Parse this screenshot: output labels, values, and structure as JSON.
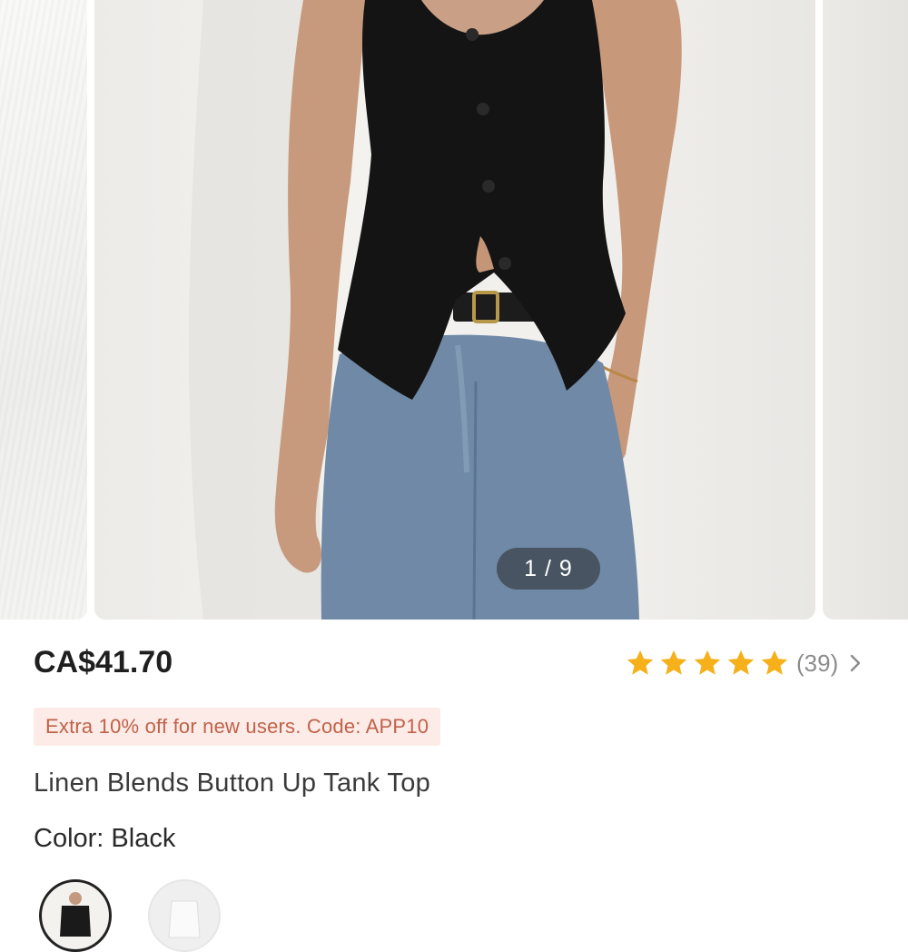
{
  "gallery": {
    "counter": "1 / 9",
    "current": 1,
    "total": 9
  },
  "product": {
    "price": "CA$41.70",
    "rating_value": 5,
    "review_count_label": "(39)",
    "promo": "Extra 10% off for new users. Code: APP10",
    "title": "Linen Blends Button Up Tank Top",
    "color_label": "Color: ",
    "color_value": "Black"
  },
  "colors": {
    "star": "#f5b01a",
    "price": "#1f1f1f",
    "promo_bg": "#fcebe6",
    "promo_text": "#c0624a"
  },
  "icons": {
    "rating": "star-icon",
    "more": "chevron-right-icon"
  },
  "swatches": [
    {
      "name": "Black",
      "selected": true
    },
    {
      "name": "White",
      "selected": false
    }
  ]
}
